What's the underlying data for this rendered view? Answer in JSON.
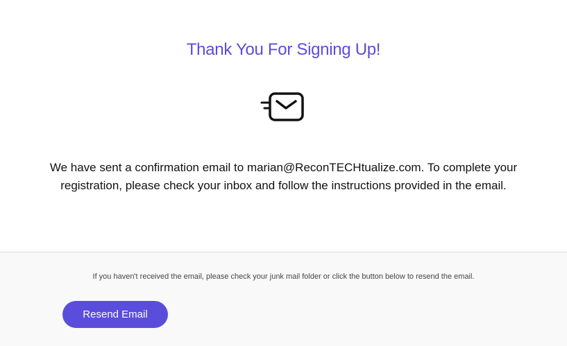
{
  "header": {
    "title": "Thank You For Signing Up!"
  },
  "icons": {
    "mail": "mail-sent-icon"
  },
  "message": {
    "text": "We have sent a confirmation email to marian@ReconTECHtualize.com. To complete your registration, please check your inbox and follow the instructions provided in the email."
  },
  "footer": {
    "note": "If you haven't received the email, please check your junk mail folder or click the button below to resend the email.",
    "resend_label": "Resend Email"
  },
  "colors": {
    "accent": "#5b4ddb",
    "text": "#111111",
    "footer_bg": "#f9f9fa"
  }
}
